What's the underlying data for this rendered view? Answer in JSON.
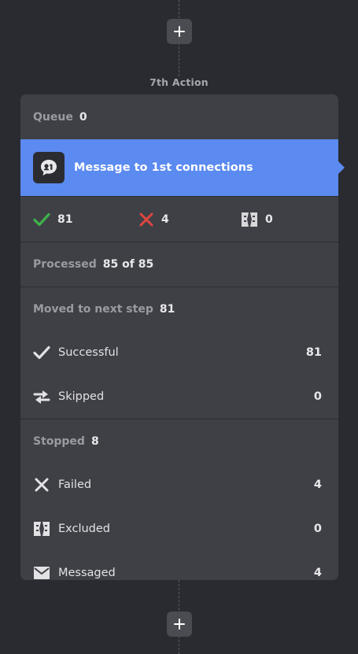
{
  "action_label": "7th Action",
  "queue": {
    "label": "Queue",
    "value": "0"
  },
  "step": {
    "title": "Message to 1st connections",
    "icon": "message-bubble-icon"
  },
  "stats": [
    {
      "name": "success",
      "value": "81",
      "color": "#3fb24a"
    },
    {
      "name": "failed",
      "value": "4",
      "color": "#e0463f"
    },
    {
      "name": "excluded",
      "value": "0",
      "color": "#d8d8da"
    }
  ],
  "processed": {
    "label": "Processed",
    "value": "85 of 85"
  },
  "moved": {
    "label": "Moved to next step",
    "value": "81",
    "rows": [
      {
        "label": "Successful",
        "value": "81",
        "icon": "check-icon"
      },
      {
        "label": "Skipped",
        "value": "0",
        "icon": "swap-arrows-icon"
      }
    ]
  },
  "stopped": {
    "label": "Stopped",
    "value": "8",
    "rows": [
      {
        "label": "Failed",
        "value": "4",
        "icon": "x-icon"
      },
      {
        "label": "Excluded",
        "value": "0",
        "icon": "excluded-icon"
      },
      {
        "label": "Messaged",
        "value": "4",
        "icon": "envelope-icon"
      }
    ]
  },
  "colors": {
    "accent": "#5b8af0",
    "card": "#3f4046",
    "background": "#2a2b30"
  }
}
